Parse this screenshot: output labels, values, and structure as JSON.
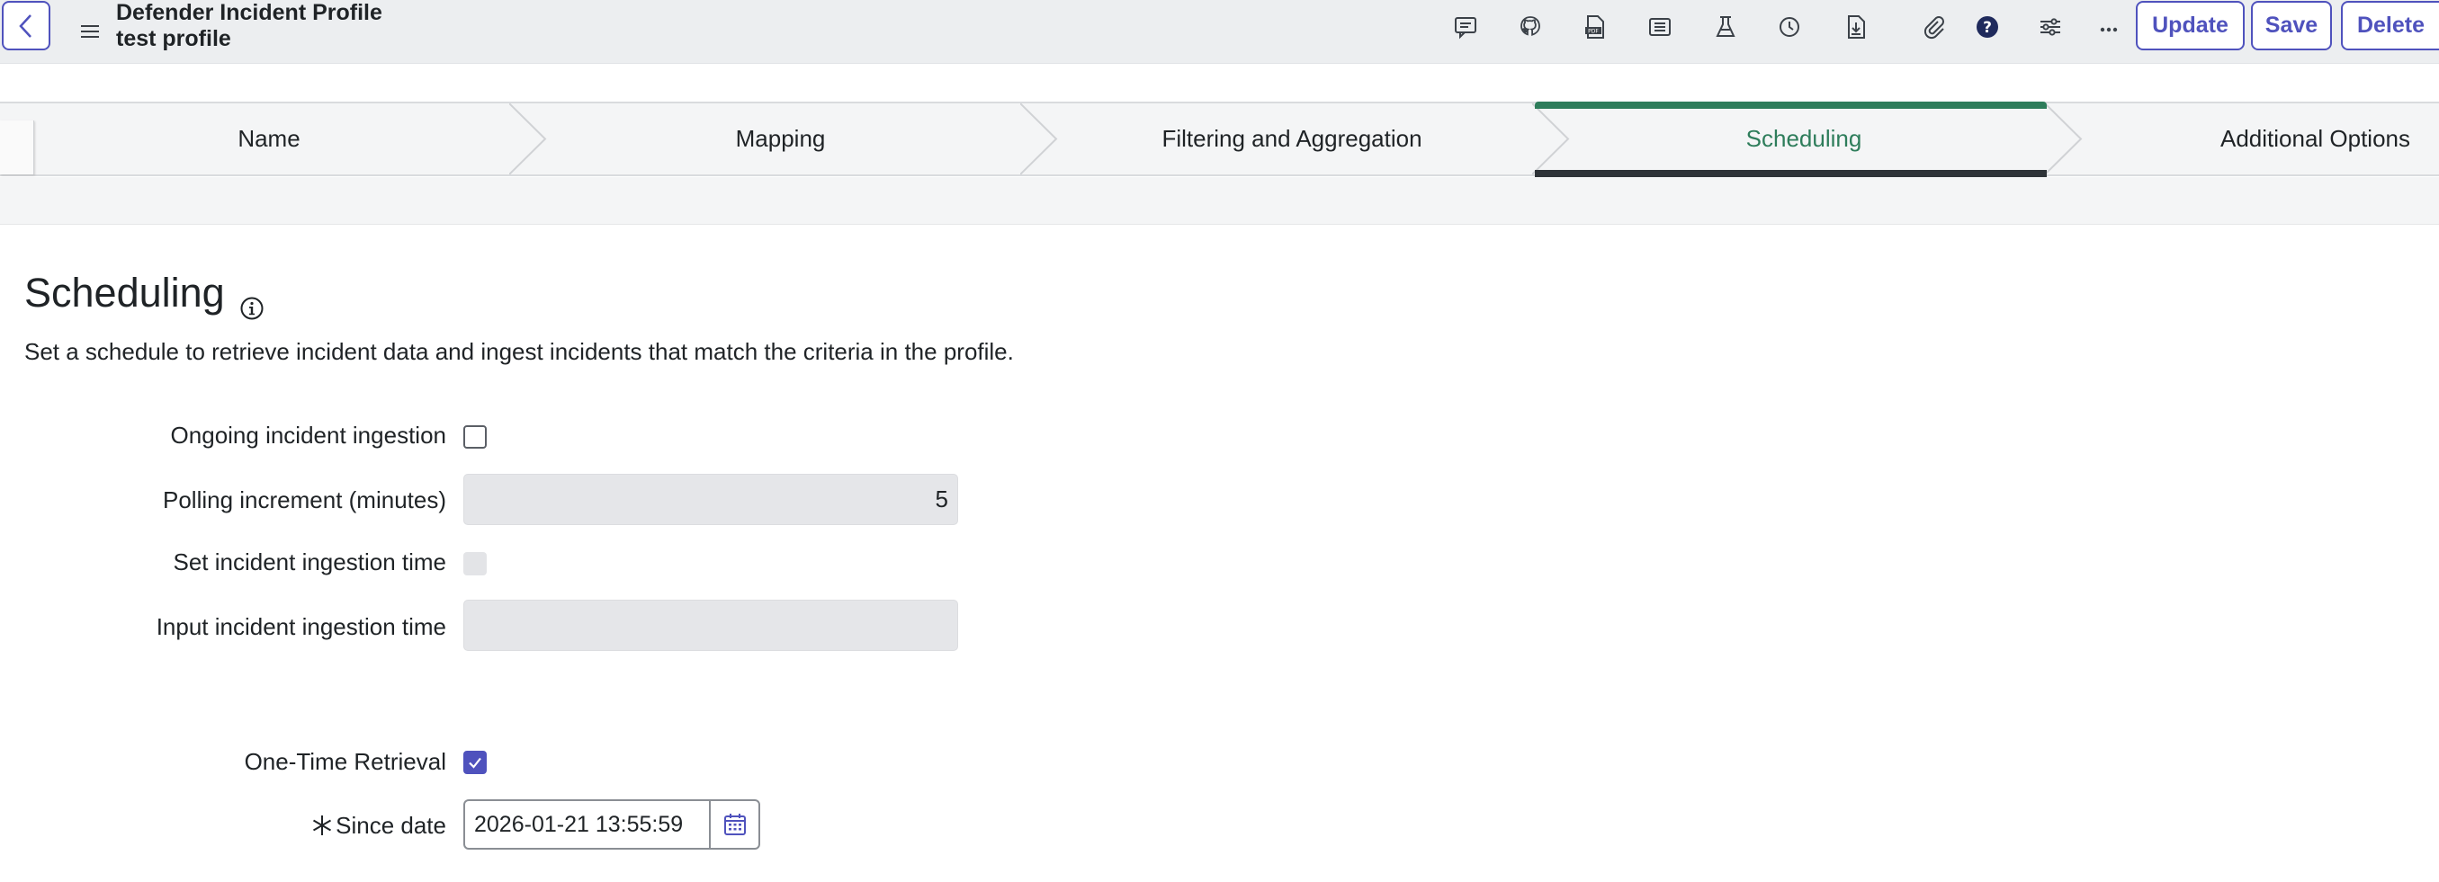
{
  "header": {
    "title": "Defender Incident Profile",
    "subtitle": "test profile",
    "toolbar_icons": [
      "comment-icon",
      "github-icon",
      "pdf-icon",
      "list-icon",
      "flask-icon",
      "clock-icon",
      "document-download-icon",
      "paperclip-icon",
      "help-icon",
      "sliders-icon",
      "more-icon"
    ],
    "update_label": "Update",
    "save_label": "Save",
    "delete_label": "Delete"
  },
  "steps": [
    {
      "label": "Name",
      "active": false
    },
    {
      "label": "Mapping",
      "active": false
    },
    {
      "label": "Filtering and Aggregation",
      "active": false
    },
    {
      "label": "Scheduling",
      "active": true
    },
    {
      "label": "Additional Options",
      "active": false
    }
  ],
  "section": {
    "title": "Scheduling",
    "description": "Set a schedule to retrieve incident data and ingest incidents that match the criteria in the profile."
  },
  "form": {
    "ongoing_label": "Ongoing incident ingestion",
    "ongoing_checked": false,
    "polling_label": "Polling increment (minutes)",
    "polling_value": "5",
    "set_time_label": "Set incident ingestion time",
    "set_time_checked": false,
    "input_time_label": "Input incident ingestion time",
    "input_time_value": "",
    "one_time_label": "One-Time Retrieval",
    "one_time_checked": true,
    "since_date_label": "Since date",
    "since_date_value": "2026-01-21 13:55:59"
  },
  "colors": {
    "accent": "#4f52bd",
    "active_step": "#2e7d5b",
    "header_bg": "#eceef0"
  }
}
